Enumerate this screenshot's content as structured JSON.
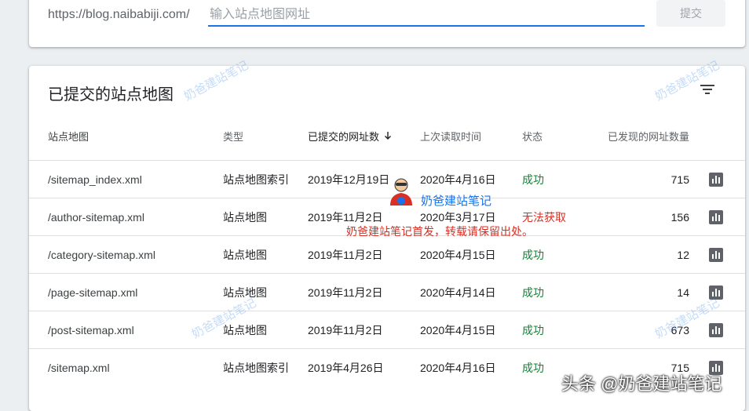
{
  "submit_bar": {
    "prefix": "https://blog.naibabiji.com/",
    "placeholder": "输入站点地图网址",
    "submit_label": "提交"
  },
  "table_card": {
    "title": "已提交的站点地图",
    "columns": {
      "path": "站点地图",
      "type": "类型",
      "submitted": "已提交的网址数",
      "last_read": "上次读取时间",
      "status": "状态",
      "discovered": "已发现的网址数量"
    },
    "rows": [
      {
        "path": "/sitemap_index.xml",
        "type": "站点地图索引",
        "submitted": "2019年12月19日",
        "last_read": "2020年4月16日",
        "status": "成功",
        "count": "715"
      },
      {
        "path": "/author-sitemap.xml",
        "type": "站点地图",
        "submitted": "2019年11月2日",
        "last_read": "2020年3月17日",
        "status": "无法获取",
        "count": "156"
      },
      {
        "path": "/category-sitemap.xml",
        "type": "站点地图",
        "submitted": "2019年11月2日",
        "last_read": "2020年4月15日",
        "status": "成功",
        "count": "12"
      },
      {
        "path": "/page-sitemap.xml",
        "type": "站点地图",
        "submitted": "2019年11月2日",
        "last_read": "2020年4月14日",
        "status": "成功",
        "count": "14"
      },
      {
        "path": "/post-sitemap.xml",
        "type": "站点地图",
        "submitted": "2019年11月2日",
        "last_read": "2020年4月15日",
        "status": "成功",
        "count": "673"
      },
      {
        "path": "/sitemap.xml",
        "type": "站点地图索引",
        "submitted": "2019年4月26日",
        "last_read": "2020年4月16日",
        "status": "成功",
        "count": "715"
      }
    ]
  },
  "overlay": {
    "watermark_text": "奶爸建站笔记",
    "center_text": "奶爸建站笔记",
    "copyright_note": "奶爸建站笔记首发，转载请保留出处。",
    "corner_mark": "头条 @奶爸建站笔记"
  },
  "colors": {
    "accent": "#1a73e8",
    "success": "#188038",
    "error": "#d93025"
  }
}
